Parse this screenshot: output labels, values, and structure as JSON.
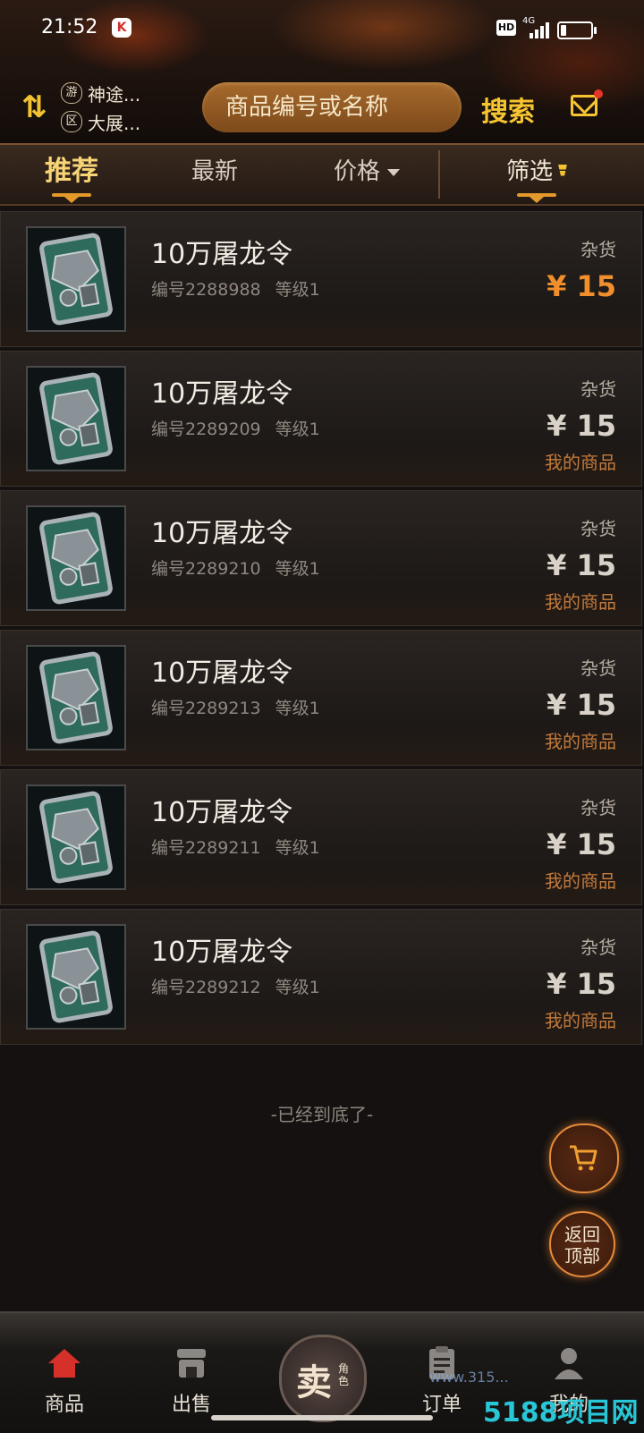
{
  "status_bar": {
    "time": "21:52",
    "hd": "HD",
    "network": "4G"
  },
  "header": {
    "server_game_badge": "游",
    "server_game": "神途...",
    "server_zone_badge": "区",
    "server_zone": "大展...",
    "search_placeholder": "商品编号或名称",
    "search_button": "搜索"
  },
  "tabs": [
    {
      "label": "推荐",
      "active": true
    },
    {
      "label": "最新",
      "active": false
    },
    {
      "label": "价格",
      "active": false
    },
    {
      "label": "筛选",
      "active": false
    }
  ],
  "items": [
    {
      "name": "10万屠龙令",
      "code": "编号2288988",
      "level": "等级1",
      "category": "杂货",
      "price": "¥ 15",
      "mine": ""
    },
    {
      "name": "10万屠龙令",
      "code": "编号2289209",
      "level": "等级1",
      "category": "杂货",
      "price": "¥ 15",
      "mine": "我的商品"
    },
    {
      "name": "10万屠龙令",
      "code": "编号2289210",
      "level": "等级1",
      "category": "杂货",
      "price": "¥ 15",
      "mine": "我的商品"
    },
    {
      "name": "10万屠龙令",
      "code": "编号2289213",
      "level": "等级1",
      "category": "杂货",
      "price": "¥ 15",
      "mine": "我的商品"
    },
    {
      "name": "10万屠龙令",
      "code": "编号2289211",
      "level": "等级1",
      "category": "杂货",
      "price": "¥ 15",
      "mine": "我的商品"
    },
    {
      "name": "10万屠龙令",
      "code": "编号2289212",
      "level": "等级1",
      "category": "杂货",
      "price": "¥ 15",
      "mine": "我的商品"
    }
  ],
  "end_message": "-已经到底了-",
  "float_buttons": {
    "back_to_top_line1": "返回",
    "back_to_top_line2": "顶部"
  },
  "bottom_nav": {
    "goods": "商品",
    "sell_out": "出售",
    "sell_center": "卖",
    "sell_center_sub": "角色",
    "orders": "订单",
    "mine": "我的"
  },
  "watermark": {
    "small": "www.315...",
    "brand": "5188项目网"
  },
  "colors": {
    "accent": "#f6c531",
    "price_highlight": "#f08f2c",
    "mine_text": "#c47a3a",
    "tab_active": "#f7d476"
  }
}
